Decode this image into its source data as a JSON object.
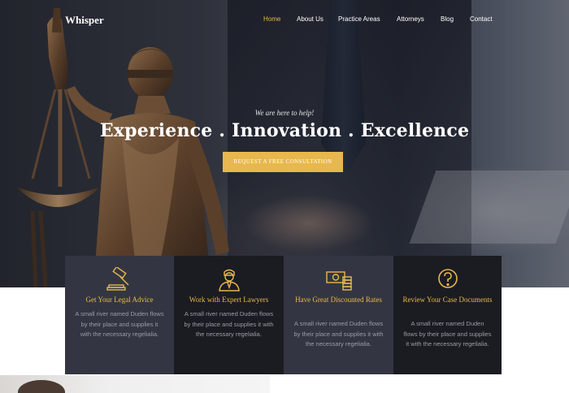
{
  "brand": {
    "logo_text": "Whisper"
  },
  "nav": {
    "items": [
      {
        "label": "Home",
        "active": true
      },
      {
        "label": "About Us",
        "active": false
      },
      {
        "label": "Practice Areas",
        "active": false
      },
      {
        "label": "Attorneys",
        "active": false
      },
      {
        "label": "Blog",
        "active": false
      },
      {
        "label": "Contact",
        "active": false
      }
    ]
  },
  "hero": {
    "tagline": "We are here to help!",
    "headline": "Experience . Innovation . Excellence",
    "cta_label": "REQUEST A FREE CONSULTATION"
  },
  "features": [
    {
      "icon": "gavel-icon",
      "title": "Get Your Legal Advice",
      "description": "A small river named Duden flows by their place and supplies it with the necessary regelialia."
    },
    {
      "icon": "lawyer-icon",
      "title": "Work with Expert Lawyers",
      "description": "A small river named Duden flows by their place and supplies it with the necessary regelialia."
    },
    {
      "icon": "money-icon",
      "title": "Have Great Discounted Rates",
      "description": "A small river named Duden flows by their place and supplies it with the necessary regelialia."
    },
    {
      "icon": "question-icon",
      "title": "Review Your Case Documents",
      "description": "A small river named Duden flows by their place and supplies it with the necessary regelialia."
    }
  ],
  "colors": {
    "accent": "#e8b74d",
    "card_light": "#333642",
    "card_dark": "#1b1c22",
    "text_muted": "#9a9ca6"
  }
}
